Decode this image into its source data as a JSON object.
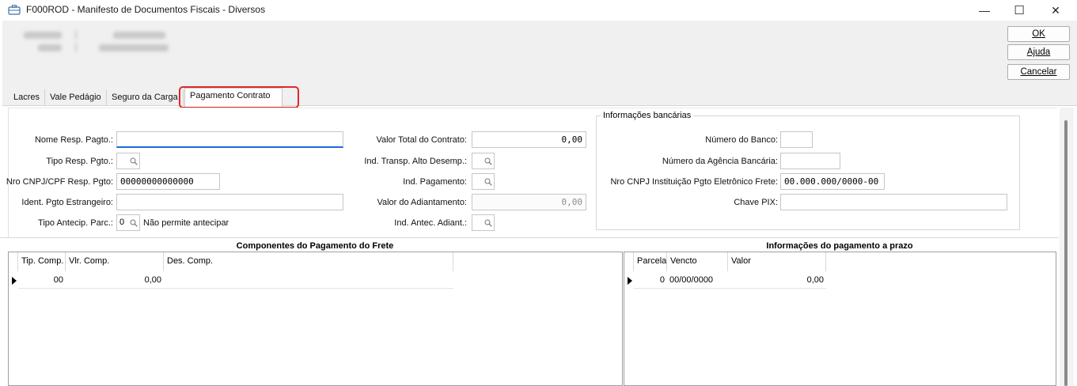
{
  "window": {
    "title": "F000ROD - Manifesto de Documentos Fiscais - Diversos",
    "minimize": "—",
    "maximize": "☐",
    "close": "✕"
  },
  "actions": {
    "ok": "OK",
    "help": "Ajuda",
    "cancel": "Cancelar"
  },
  "tabs": [
    {
      "label": "Lacres"
    },
    {
      "label": "Vale Pedágio"
    },
    {
      "label": "Seguro da Carga"
    },
    {
      "label": "Pagamento Contrato",
      "active": true
    }
  ],
  "form": {
    "nome_resp_label": "Nome Resp. Pagto.:",
    "nome_resp_value": "",
    "tipo_resp_label": "Tipo Resp. Pgto.:",
    "nro_cnpj_label": "Nro CNPJ/CPF Resp. Pgto:",
    "nro_cnpj_value": "00000000000000",
    "ident_label": "Ident. Pgto Estrangeiro:",
    "ident_value": "",
    "tipo_antecip_label": "Tipo Antecip. Parc.:",
    "tipo_antecip_value": "0",
    "tipo_antecip_desc": "Não permite antecipar",
    "valor_total_label": "Valor Total do Contrato:",
    "valor_total_value": "0,00",
    "ind_transp_label": "Ind. Transp. Alto Desemp.:",
    "ind_pagamento_label": "Ind. Pagamento:",
    "valor_adiant_label": "Valor do Adiantamento:",
    "valor_adiant_value": "0,00",
    "ind_antec_label": "Ind. Antec. Adiant.:"
  },
  "bank": {
    "group_title": "Informações bancárias",
    "numero_banco_label": "Número do Banco:",
    "numero_banco_value": "",
    "numero_agencia_label": "Número da Agência Bancária:",
    "numero_agencia_value": "",
    "cnpj_ipef_label": "Nro CNPJ Instituição Pgto Eletrônico Frete:",
    "cnpj_ipef_value": "00.000.000/0000-00",
    "chave_pix_label": "Chave PIX:",
    "chave_pix_value": ""
  },
  "components_grid": {
    "title": "Componentes do Pagamento do Frete",
    "columns": [
      "Tip. Comp.",
      "Vlr. Comp.",
      "Des. Comp."
    ],
    "rows": [
      [
        "00",
        "0,00",
        ""
      ]
    ]
  },
  "installments_grid": {
    "title": "Informações do pagamento a prazo",
    "columns": [
      "Parcela",
      "Vencto",
      "Valor"
    ],
    "rows": [
      [
        "0",
        "00/00/0000",
        "0,00"
      ]
    ]
  }
}
